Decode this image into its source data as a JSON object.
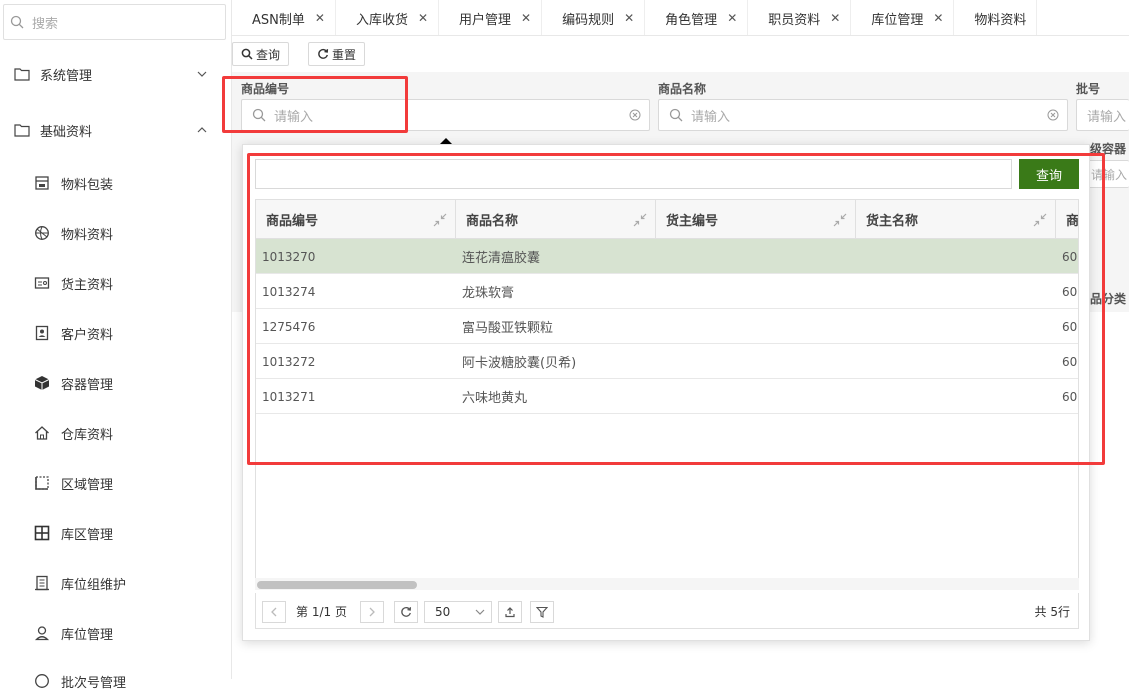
{
  "sidebar": {
    "search_placeholder": "搜索",
    "groups": [
      {
        "label": "系统管理"
      },
      {
        "label": "基础资料"
      }
    ],
    "items": [
      {
        "label": "物料包装",
        "icon": "package-icon"
      },
      {
        "label": "物料资料",
        "icon": "basketball-icon"
      },
      {
        "label": "货主资料",
        "icon": "id-card-icon"
      },
      {
        "label": "客户资料",
        "icon": "contact-book-icon"
      },
      {
        "label": "容器管理",
        "icon": "cube-icon"
      },
      {
        "label": "仓库资料",
        "icon": "home-icon"
      },
      {
        "label": "区域管理",
        "icon": "area-icon"
      },
      {
        "label": "库区管理",
        "icon": "grid-icon"
      },
      {
        "label": "库位组维护",
        "icon": "building-icon"
      },
      {
        "label": "库位管理",
        "icon": "user-location-icon"
      },
      {
        "label": "批次号管理",
        "icon": "clock-icon"
      }
    ]
  },
  "tabs": [
    {
      "label": "ASN制单"
    },
    {
      "label": "入库收货"
    },
    {
      "label": "用户管理"
    },
    {
      "label": "编码规则"
    },
    {
      "label": "角色管理"
    },
    {
      "label": "职员资料"
    },
    {
      "label": "库位管理"
    },
    {
      "label": "物料资料"
    }
  ],
  "toolbar": {
    "query_label": "查询",
    "reset_label": "重置"
  },
  "form": {
    "fields": [
      {
        "label": "商品编号",
        "placeholder": "请输入"
      },
      {
        "label": "商品名称",
        "placeholder": "请输入"
      },
      {
        "label": "批号",
        "placeholder": "请输入"
      }
    ],
    "partial_labels": {
      "container_level": "级容器",
      "product_category": "品分类"
    },
    "partial_input_placeholder": "请输入"
  },
  "popup": {
    "search_value": "",
    "query_label": "查询",
    "columns": [
      "商品编号",
      "商品名称",
      "货主编号",
      "货主名称",
      "商"
    ],
    "rows": [
      {
        "code": "1013270",
        "name": "连花清瘟胶囊",
        "owner_code": "",
        "owner_name": "",
        "extra": "60"
      },
      {
        "code": "1013274",
        "name": "龙珠软膏",
        "owner_code": "",
        "owner_name": "",
        "extra": "60"
      },
      {
        "code": "1275476",
        "name": "富马酸亚铁颗粒",
        "owner_code": "",
        "owner_name": "",
        "extra": "60"
      },
      {
        "code": "1013272",
        "name": "阿卡波糖胶囊(贝希)",
        "owner_code": "",
        "owner_name": "",
        "extra": "60"
      },
      {
        "code": "1013271",
        "name": "六味地黄丸",
        "owner_code": "",
        "owner_name": "",
        "extra": "60"
      }
    ],
    "pager": {
      "page_text": "第 1/1 页",
      "page_size": "50",
      "total_text": "共 5行"
    }
  },
  "colors": {
    "accent_green": "#3a7a18",
    "selected_row": "#d7e3d1",
    "highlight_red": "#f23b3b"
  }
}
